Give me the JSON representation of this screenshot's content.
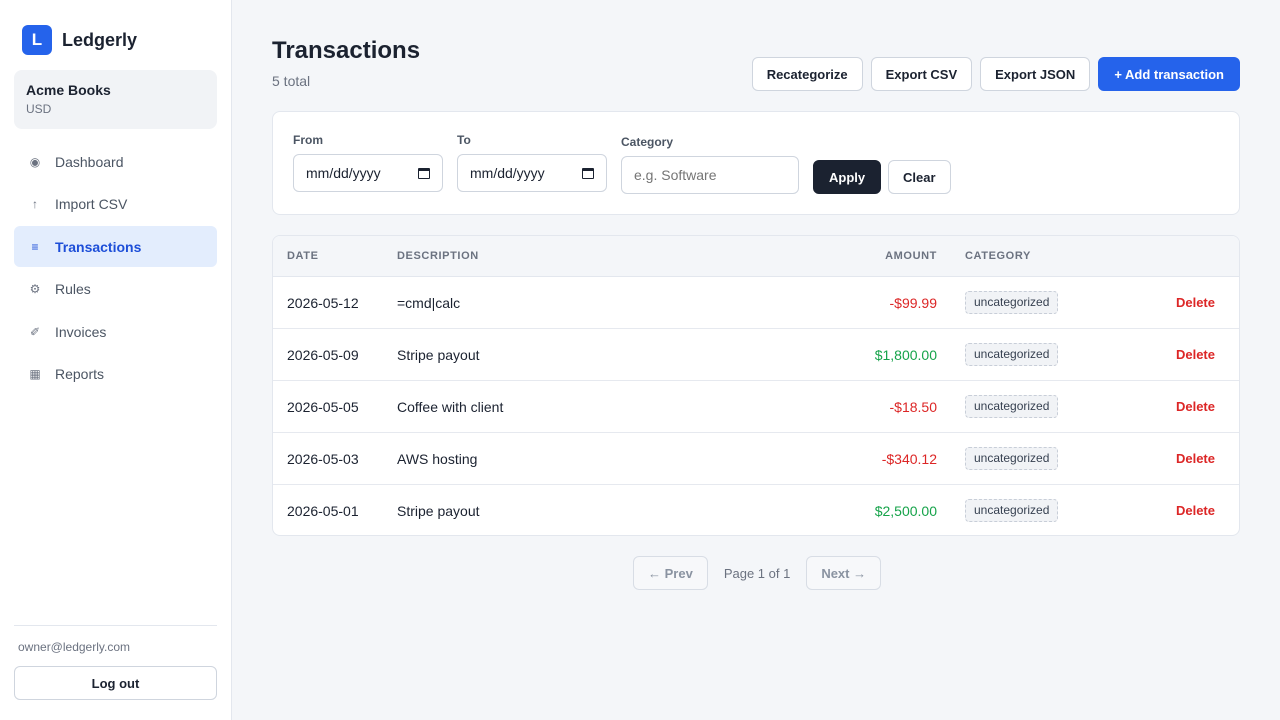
{
  "brand": {
    "logo_letter": "L",
    "name": "Ledgerly"
  },
  "org": {
    "name": "Acme Books",
    "currency": "USD"
  },
  "nav": [
    {
      "label": "Dashboard",
      "icon": "◉",
      "icon_name": "dashboard-icon"
    },
    {
      "label": "Import CSV",
      "icon": "↑",
      "icon_name": "upload-icon"
    },
    {
      "label": "Transactions",
      "icon": "≡",
      "icon_name": "list-icon"
    },
    {
      "label": "Rules",
      "icon": "⚙",
      "icon_name": "gear-icon"
    },
    {
      "label": "Invoices",
      "icon": "✐",
      "icon_name": "invoice-icon"
    },
    {
      "label": "Reports",
      "icon": "▦",
      "icon_name": "reports-icon"
    }
  ],
  "user": {
    "email": "owner@ledgerly.com",
    "logout_label": "Log out"
  },
  "page": {
    "title": "Transactions",
    "subtitle": "5 total"
  },
  "actions": {
    "recategorize": "Recategorize",
    "export_csv": "Export CSV",
    "export_json": "Export JSON",
    "add": "+ Add transaction"
  },
  "filters": {
    "from_label": "From",
    "from_value": "mm/dd/yyyy",
    "to_label": "To",
    "to_value": "mm/dd/yyyy",
    "category_label": "Category",
    "category_placeholder": "e.g. Software",
    "apply": "Apply",
    "clear": "Clear"
  },
  "table": {
    "columns": {
      "date": "DATE",
      "description": "DESCRIPTION",
      "amount": "AMOUNT",
      "category": "CATEGORY"
    },
    "rows": [
      {
        "date": "2026-05-12",
        "description": "=cmd|calc",
        "amount": "-$99.99",
        "sign": "neg",
        "category": "uncategorized",
        "action": "Delete"
      },
      {
        "date": "2026-05-09",
        "description": "Stripe payout",
        "amount": "$1,800.00",
        "sign": "pos",
        "category": "uncategorized",
        "action": "Delete"
      },
      {
        "date": "2026-05-05",
        "description": "Coffee with client",
        "amount": "-$18.50",
        "sign": "neg",
        "category": "uncategorized",
        "action": "Delete"
      },
      {
        "date": "2026-05-03",
        "description": "AWS hosting",
        "amount": "-$340.12",
        "sign": "neg",
        "category": "uncategorized",
        "action": "Delete"
      },
      {
        "date": "2026-05-01",
        "description": "Stripe payout",
        "amount": "$2,500.00",
        "sign": "pos",
        "category": "uncategorized",
        "action": "Delete"
      }
    ]
  },
  "pagination": {
    "prev": "← Prev",
    "info": "Page 1 of 1",
    "next": "Next →"
  },
  "colors": {
    "accent": "#2563eb",
    "negative": "#dc2626",
    "positive": "#16a34a",
    "dark": "#1b2230"
  },
  "active_nav": "Transactions"
}
